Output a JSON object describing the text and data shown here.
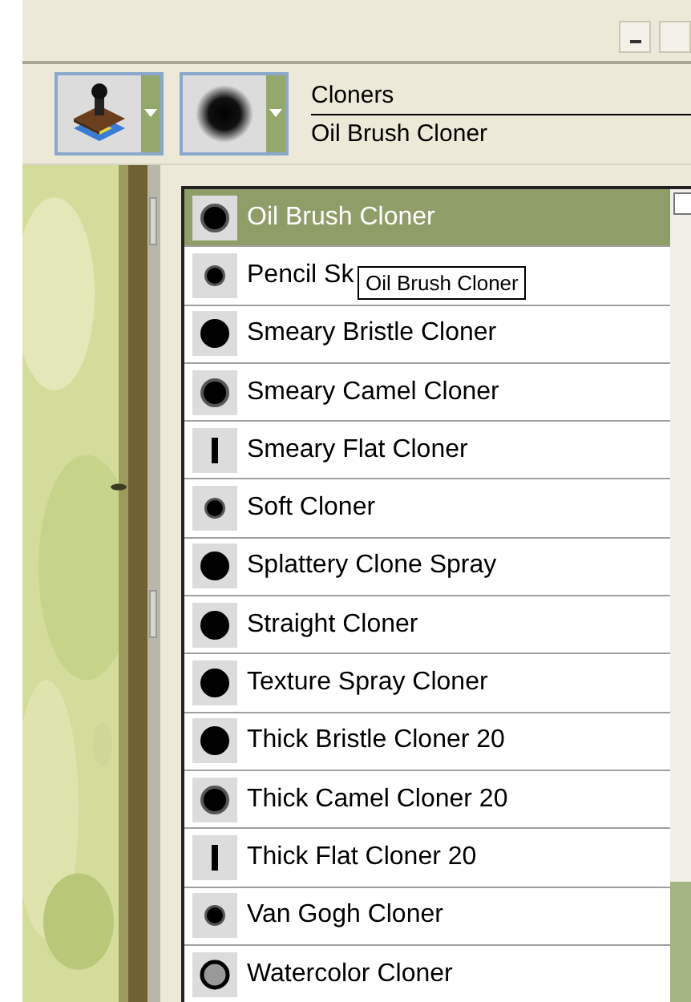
{
  "category": {
    "name": "Cloners",
    "variant": "Oil Brush Cloner"
  },
  "variants": [
    {
      "label": "Oil Brush Cloner",
      "kind": "soft",
      "selected": true
    },
    {
      "label": "Pencil Sk",
      "kind": "small",
      "selected": false
    },
    {
      "label": "Smeary Bristle Cloner",
      "kind": "hard",
      "selected": false
    },
    {
      "label": "Smeary Camel Cloner",
      "kind": "soft",
      "selected": false
    },
    {
      "label": "Smeary Flat Cloner",
      "kind": "flat",
      "selected": false
    },
    {
      "label": "Soft Cloner",
      "kind": "small",
      "selected": false
    },
    {
      "label": "Splattery Clone Spray",
      "kind": "hard",
      "selected": false
    },
    {
      "label": "Straight Cloner",
      "kind": "hard",
      "selected": false
    },
    {
      "label": "Texture Spray Cloner",
      "kind": "hard",
      "selected": false
    },
    {
      "label": "Thick Bristle Cloner 20",
      "kind": "hard",
      "selected": false
    },
    {
      "label": "Thick Camel Cloner 20",
      "kind": "soft",
      "selected": false
    },
    {
      "label": "Thick Flat Cloner 20",
      "kind": "flat",
      "selected": false
    },
    {
      "label": "Van Gogh Cloner",
      "kind": "small",
      "selected": false
    },
    {
      "label": "Watercolor Cloner",
      "kind": "ring",
      "selected": false
    }
  ],
  "tooltip": "Oil Brush Cloner"
}
